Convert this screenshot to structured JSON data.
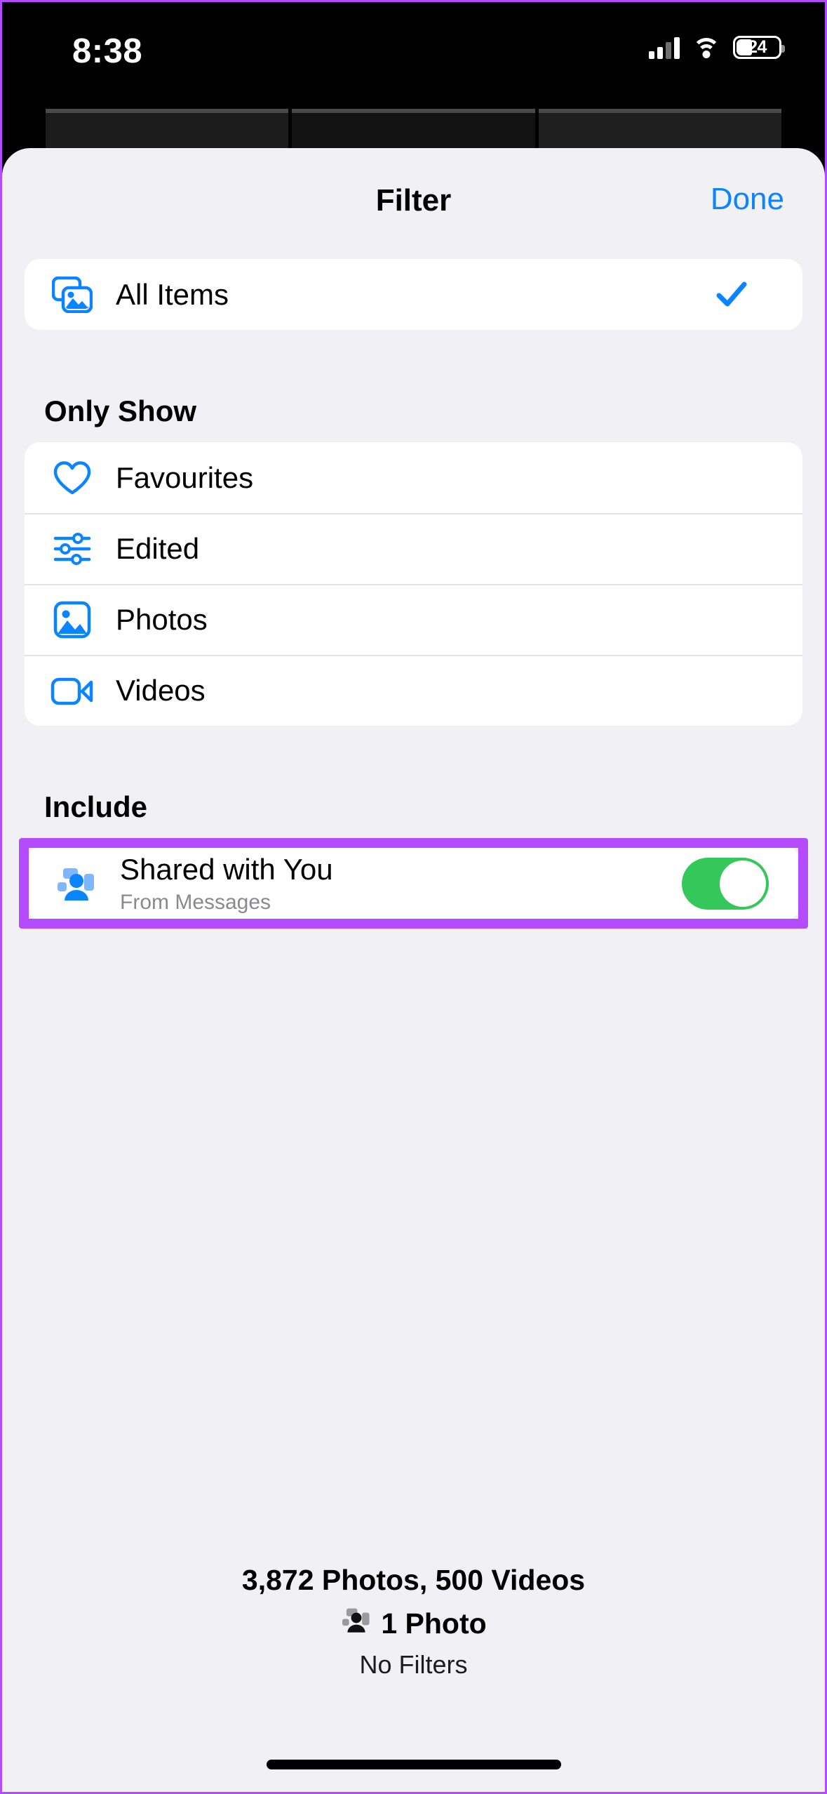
{
  "status_bar": {
    "time": "8:38",
    "battery_percent": "24",
    "cellular_icon": "cellular-signal-icon",
    "wifi_icon": "wifi-icon",
    "battery_icon": "battery-icon"
  },
  "sheet": {
    "title": "Filter",
    "done_label": "Done"
  },
  "all_items": {
    "label": "All Items",
    "icon": "photo-stack-icon",
    "checked": true,
    "check_icon": "checkmark-icon"
  },
  "only_show": {
    "header": "Only Show",
    "items": [
      {
        "label": "Favourites",
        "icon": "heart-icon"
      },
      {
        "label": "Edited",
        "icon": "sliders-icon"
      },
      {
        "label": "Photos",
        "icon": "photo-icon"
      },
      {
        "label": "Videos",
        "icon": "video-camera-icon"
      }
    ]
  },
  "include": {
    "header": "Include",
    "item": {
      "label": "Shared with You",
      "sublabel": "From Messages",
      "icon": "shared-with-you-icon",
      "toggle_on": true
    },
    "highlight_color": "#b44bff"
  },
  "summary": {
    "counts": "3,872 Photos, 500 Videos",
    "shared_icon": "shared-with-you-icon",
    "shared_count": "1 Photo",
    "filters": "No Filters"
  },
  "colors": {
    "accent_blue": "#0a84ff",
    "toggle_green": "#34c759",
    "sheet_bg": "#f1f0f5",
    "card_bg": "#ffffff",
    "highlight_purple": "#b44bff"
  }
}
